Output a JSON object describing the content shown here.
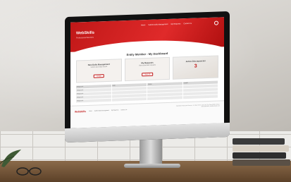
{
  "brand": {
    "name": "WebSkills",
    "tagline": "Professional Services"
  },
  "nav": {
    "items": [
      "Home",
      "Submit Daily Management",
      "My Requests",
      "Contact Us"
    ]
  },
  "page": {
    "title": "Entity Member - My Dashboard"
  },
  "cards": [
    {
      "title": "New Daily Management",
      "subtitle": "Submit your daily record",
      "button": "Create"
    },
    {
      "title": "My Requests",
      "subtitle": "View submitted requests",
      "button": "View All"
    },
    {
      "title": "Active Discrepancies",
      "subtitle": "",
      "count": "3"
    }
  ],
  "table": {
    "headers": [
      "Request #",
      "Date",
      "Status",
      "Details"
    ],
    "rows": [
      [
        "Request #",
        "",
        "",
        ""
      ],
      [
        "Request #",
        "",
        "",
        ""
      ],
      [
        "Request #",
        "",
        "",
        ""
      ],
      [
        "Request #",
        "",
        "",
        ""
      ]
    ]
  },
  "footer": {
    "logo": "WebSkills",
    "links": [
      "Home",
      "Submit Daily Management",
      "My Requests",
      "Contact Us"
    ],
    "address": "WebSkills Professional Services, 123 Main Street, Suite 100, City, State 00000 | Phone: (000) 000-0000 | info@webskills.com"
  },
  "colors": {
    "brand_red": "#c01818",
    "monitor_bezel": "#111111"
  }
}
